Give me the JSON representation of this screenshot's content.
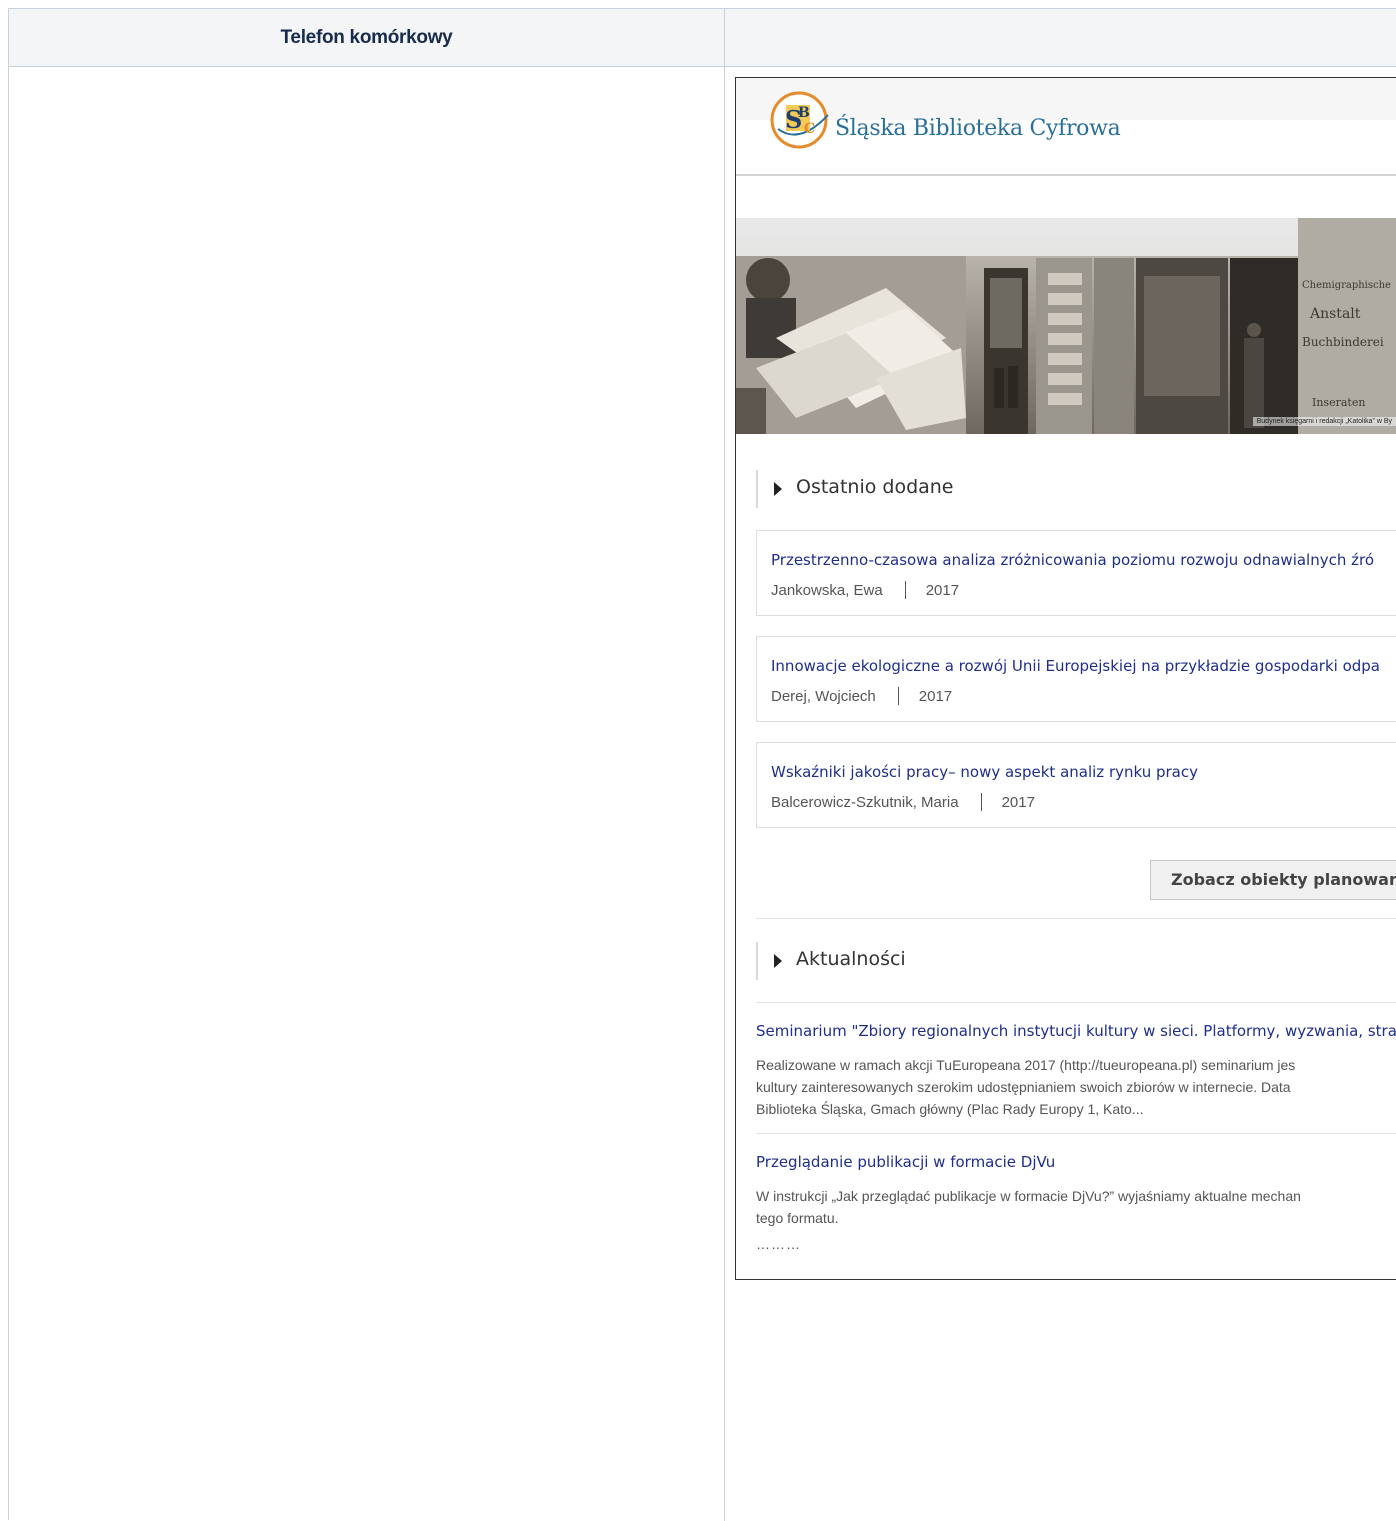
{
  "table": {
    "col1_header": "Telefon komórkowy",
    "col2_header": ""
  },
  "site": {
    "logo_letters": "SBC",
    "name": "Śląska Biblioteka Cyfrowa"
  },
  "banner": {
    "caption": "Budynek księgarni i redakcji „Katolika” w By",
    "sign_lines": [
      "Chemigraphische",
      "Anstalt",
      "Buchbinderei",
      "Inseraten"
    ]
  },
  "recent": {
    "heading": "Ostatnio dodane",
    "items": [
      {
        "title": "Przestrzenno-czasowa analiza zróżnicowania poziomu rozwoju odnawialnych źró",
        "author": "Jankowska, Ewa",
        "year": "2017"
      },
      {
        "title": "Innowacje ekologiczne a rozwój Unii Europejskiej na przykładzie gospodarki odpa",
        "author": "Derej, Wojciech",
        "year": "2017"
      },
      {
        "title": "Wskaźniki jakości pracy– nowy aspekt analiz rynku pracy",
        "author": "Balcerowicz-Szkutnik, Maria",
        "year": "2017"
      }
    ],
    "button_label": "Zobacz obiekty planowane"
  },
  "news": {
    "heading": "Aktualności",
    "items": [
      {
        "title": "Seminarium \"Zbiory regionalnych instytucji kultury w sieci. Platformy, wyzwania, stra",
        "body": [
          "Realizowane w ramach akcji TuEuropeana 2017 (http://tueuropeana.pl) seminarium jes",
          "kultury zainteresowanych szerokim udostępnianiem swoich zbiorów w internecie. Data",
          "Biblioteka Śląska, Gmach główny (Plac Rady Europy 1, Kato..."
        ]
      },
      {
        "title": "Przeglądanie publikacji w formacie DjVu",
        "body": [
          "W instrukcji „Jak przeglądać publikacje w formacie DjVu?” wyjaśniamy aktualne mechan",
          "tego formatu."
        ]
      }
    ],
    "more": "………"
  },
  "colors": {
    "link": "#1f2e8c",
    "site_name": "#2a6f9a",
    "logo_orange": "#e8892c",
    "header_bg": "#f4f5f7"
  }
}
